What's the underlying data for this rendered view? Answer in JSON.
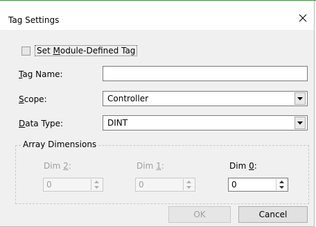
{
  "window": {
    "title": "Tag Settings"
  },
  "module_defined": {
    "label_prefix": "Set ",
    "label_accel": "M",
    "label_rest": "odule-Defined Tag",
    "checked": false
  },
  "tag_name": {
    "label_accel": "T",
    "label_rest": "ag Name:",
    "value": ""
  },
  "scope": {
    "label_accel": "S",
    "label_rest": "cope:",
    "value": "Controller"
  },
  "data_type": {
    "label_accel": "D",
    "label_rest": "ata Type:",
    "value": "DINT"
  },
  "array_dimensions": {
    "title": "Array Dimensions",
    "dims": [
      {
        "label_prefix": "Dim ",
        "label_accel": "2",
        "label_suffix": ":",
        "value": "0",
        "enabled": false
      },
      {
        "label_prefix": "Dim ",
        "label_accel": "1",
        "label_suffix": ":",
        "value": "0",
        "enabled": false
      },
      {
        "label_prefix": "Dim ",
        "label_accel": "0",
        "label_suffix": ":",
        "value": "0",
        "enabled": true
      }
    ]
  },
  "buttons": {
    "ok": "OK",
    "cancel": "Cancel"
  }
}
